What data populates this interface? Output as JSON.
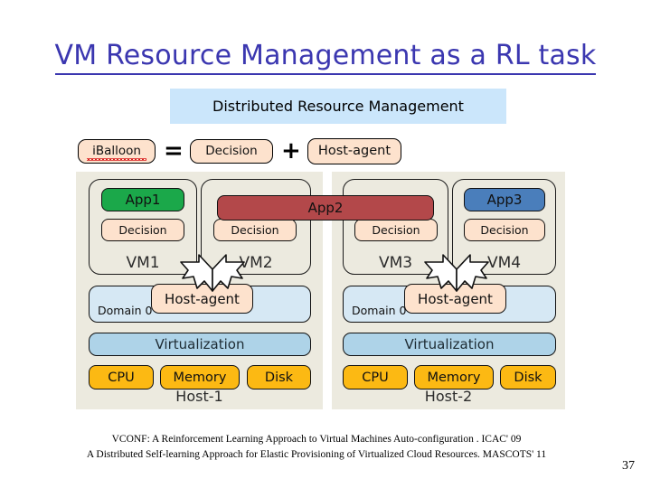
{
  "slide": {
    "title": "VM Resource Management as a RL task",
    "title_color": "#3b37b0",
    "page_number": "37",
    "background": "#ffffff"
  },
  "banner": {
    "text": "Distributed Resource Management",
    "background": "#cbe6fb"
  },
  "equation": {
    "left_term": "iBalloon",
    "equals": "=",
    "term2": "Decision",
    "plus": "+",
    "term3": "Host-agent",
    "pill_background": "#fde2cd"
  },
  "hosts": [
    {
      "name": "Host-1",
      "panel_background": "#eceadf",
      "vms": [
        {
          "name": "VM1",
          "app": {
            "label": "App1",
            "color": "#1ba84a",
            "spans_hosts": false
          },
          "decision": "Decision"
        },
        {
          "name": "VM2",
          "app": {
            "label": "App2",
            "color": "#b3484a",
            "spans_hosts": true
          },
          "decision": "Decision"
        }
      ],
      "domain": {
        "label": "Domain 0",
        "background": "#d6e8f4"
      },
      "host_agent": "Host-agent",
      "virtualization": {
        "label": "Virtualization",
        "background": "#aed3e8"
      },
      "resources": [
        {
          "label": "CPU",
          "color": "#fcb913"
        },
        {
          "label": "Memory",
          "color": "#fcb913"
        },
        {
          "label": "Disk",
          "color": "#fcb913"
        }
      ]
    },
    {
      "name": "Host-2",
      "panel_background": "#eceadf",
      "vms": [
        {
          "name": "VM3",
          "app": {
            "label": "",
            "color": "#b3484a",
            "spans_hosts": true
          },
          "decision": "Decision"
        },
        {
          "name": "VM4",
          "app": {
            "label": "App3",
            "color": "#4a7ebb",
            "spans_hosts": false
          },
          "decision": "Decision"
        }
      ],
      "domain": {
        "label": "Domain 0",
        "background": "#d6e8f4"
      },
      "host_agent": "Host-agent",
      "virtualization": {
        "label": "Virtualization",
        "background": "#aed3e8"
      },
      "resources": [
        {
          "label": "CPU",
          "color": "#fcb913"
        },
        {
          "label": "Memory",
          "color": "#fcb913"
        },
        {
          "label": "Disk",
          "color": "#fcb913"
        }
      ]
    }
  ],
  "footer": {
    "line1": "VCONF: A Reinforcement Learning Approach to Virtual Machines Auto-configuration . ICAC' 09",
    "line2": "A Distributed Self-learning Approach for Elastic Provisioning of Virtualized Cloud Resources. MASCOTS' 11"
  }
}
